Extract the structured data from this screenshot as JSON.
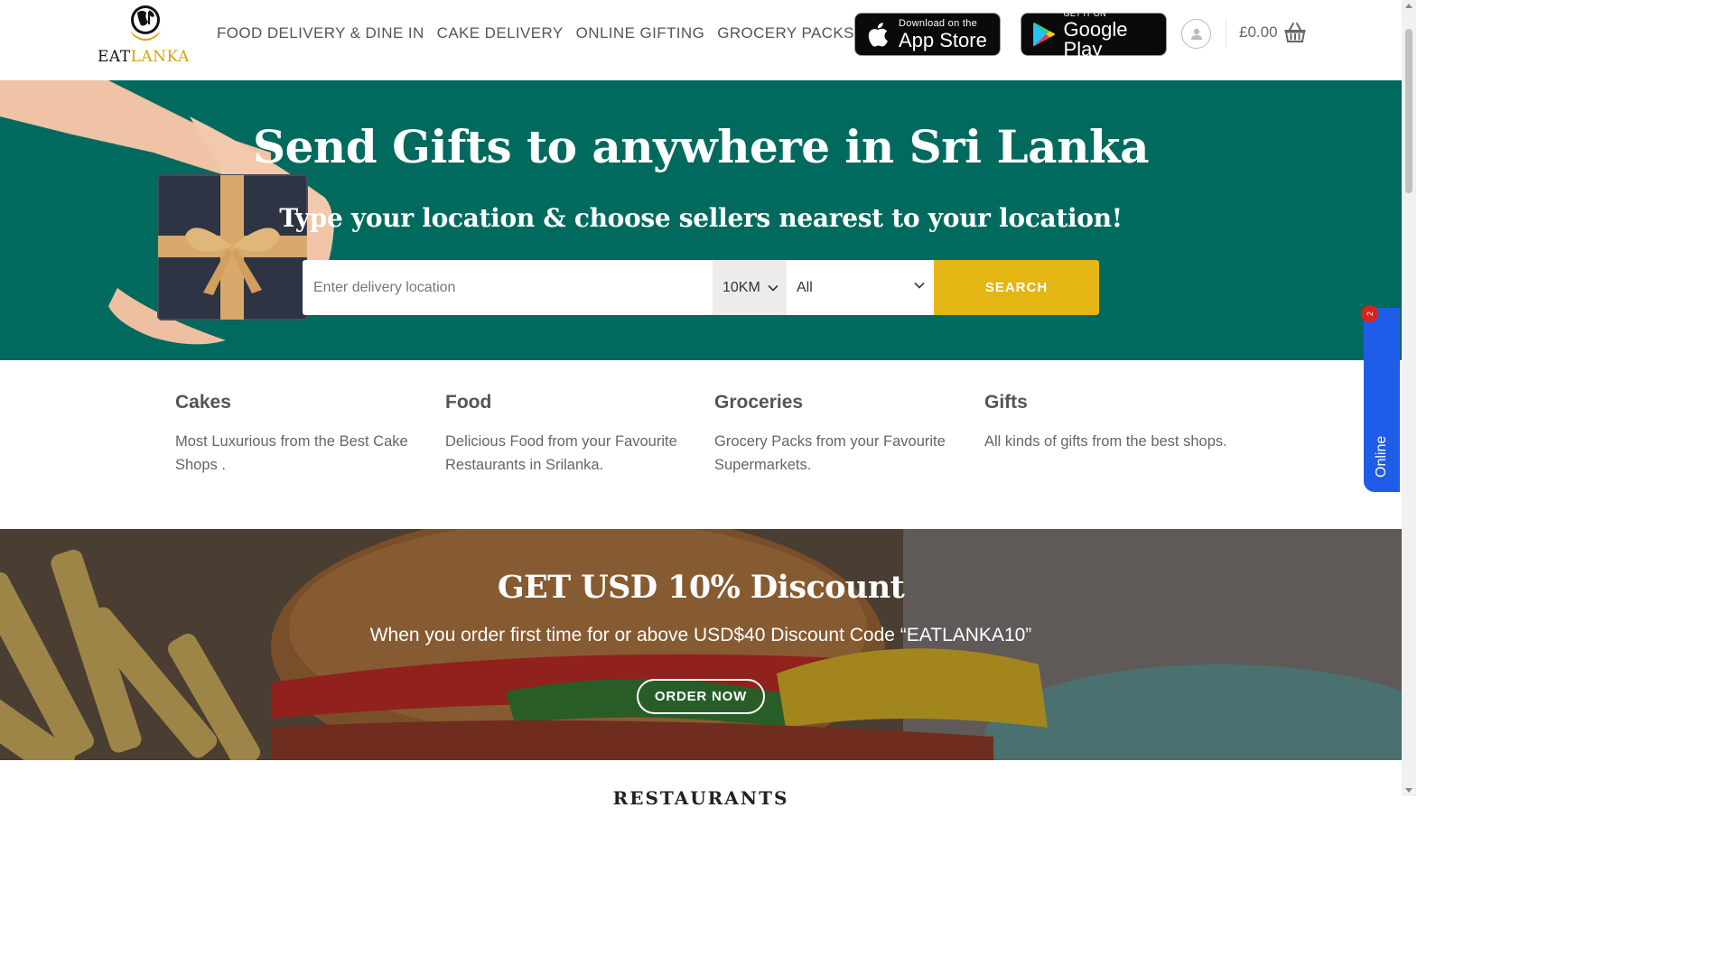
{
  "brand": {
    "eat": "EAT",
    "lanka": "LANKA"
  },
  "nav": [
    {
      "label": "FOOD DELIVERY & DINE IN"
    },
    {
      "label": "CAKE DELIVERY"
    },
    {
      "label": "ONLINE GIFTING"
    },
    {
      "label": "GROCERY PACKS"
    }
  ],
  "app_store": {
    "small": "Download on the",
    "big": "App Store",
    "icon": "apple-icon"
  },
  "google_play": {
    "small": "GET IT ON",
    "big": "Google Play",
    "icon": "google-play-icon"
  },
  "cart": {
    "amount": "£0.00",
    "icon": "basket-icon"
  },
  "hero": {
    "title": "Send Gifts to anywhere in Sri Lanka",
    "subtitle": "Type your location & choose sellers nearest to your location!",
    "search": {
      "placeholder": "Enter delivery location",
      "distance": "10KM",
      "category": "All",
      "button": "SEARCH"
    }
  },
  "categories": [
    {
      "title": "Cakes",
      "description": "Most Luxurious from the Best Cake Shops ."
    },
    {
      "title": "Food",
      "description": "Delicious Food from your Favourite Restaurants in Srilanka."
    },
    {
      "title": "Groceries",
      "description": "Grocery Packs from your Favourite Supermarkets."
    },
    {
      "title": "Gifts",
      "description": "All kinds of gifts from the best shops."
    }
  ],
  "promo": {
    "title": "GET USD 10% Discount",
    "subtitle": "When you order first time for or above USD$40 Discount Code “EATLANKA10”",
    "button": "ORDER NOW"
  },
  "next_section": {
    "heading": "RESTAURANTS"
  },
  "online_widget": {
    "label": "Online",
    "badge": "2"
  },
  "colors": {
    "hero_bg": "#006a5e",
    "accent": "#e4b614",
    "online_widget": "#1f5ce8",
    "badge": "#d8221c"
  }
}
